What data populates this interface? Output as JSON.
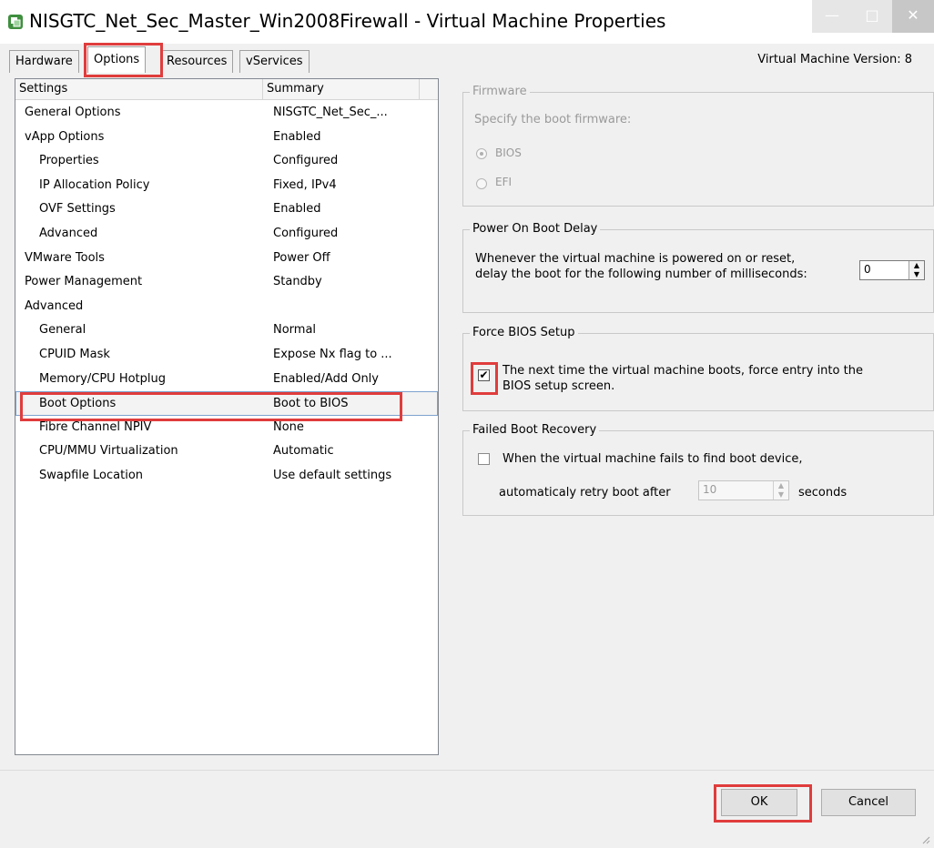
{
  "window": {
    "title": "NISGTC_Net_Sec_Master_Win2008Firewall - Virtual Machine Properties",
    "minimize_glyph": "—",
    "maximize_glyph": "□",
    "close_glyph": "✕"
  },
  "tabs": [
    {
      "label": "Hardware"
    },
    {
      "label": "Options"
    },
    {
      "label": "Resources"
    },
    {
      "label": "vServices"
    }
  ],
  "vm_version": "Virtual Machine Version: 8",
  "settings_list": {
    "col_settings": "Settings",
    "col_summary": "Summary",
    "rows": [
      {
        "setting": "General Options",
        "summary": "NISGTC_Net_Sec_..."
      },
      {
        "setting": "vApp Options",
        "summary": "Enabled"
      },
      {
        "setting": "Properties",
        "summary": "Configured"
      },
      {
        "setting": "IP Allocation Policy",
        "summary": "Fixed, IPv4"
      },
      {
        "setting": "OVF Settings",
        "summary": "Enabled"
      },
      {
        "setting": "Advanced",
        "summary": "Configured"
      },
      {
        "setting": "VMware Tools",
        "summary": "Power Off"
      },
      {
        "setting": "Power Management",
        "summary": "Standby"
      },
      {
        "setting": "Advanced",
        "summary": ""
      },
      {
        "setting": "General",
        "summary": "Normal"
      },
      {
        "setting": "CPUID Mask",
        "summary": "Expose Nx flag to ..."
      },
      {
        "setting": "Memory/CPU Hotplug",
        "summary": "Enabled/Add Only"
      },
      {
        "setting": "Boot Options",
        "summary": "Boot to BIOS"
      },
      {
        "setting": "Fibre Channel NPIV",
        "summary": "None"
      },
      {
        "setting": "CPU/MMU Virtualization",
        "summary": "Automatic"
      },
      {
        "setting": "Swapfile Location",
        "summary": "Use default settings"
      }
    ]
  },
  "firmware": {
    "legend": "Firmware",
    "prompt": "Specify the boot firmware:",
    "option_bios": "BIOS",
    "option_efi": "EFI"
  },
  "boot_delay": {
    "legend": "Power On Boot Delay",
    "line1": "Whenever the virtual machine is powered on or reset,",
    "line2": "delay the boot for the following number of milliseconds:",
    "value": "0"
  },
  "force_bios": {
    "legend": "Force BIOS Setup",
    "line1": "The next time the virtual machine boots, force entry into the",
    "line2": "BIOS setup screen.",
    "check_glyph": "✔"
  },
  "failed_boot": {
    "legend": "Failed Boot Recovery",
    "line1": "When the virtual machine fails to find boot device,",
    "line2_prefix": "automaticaly retry boot after",
    "value": "10",
    "suffix": "seconds"
  },
  "buttons": {
    "ok": "OK",
    "cancel": "Cancel"
  },
  "colors": {
    "highlight": "#e03c3c",
    "selection_border": "#7da2ce",
    "dialog_bg": "#f0f0f0"
  }
}
